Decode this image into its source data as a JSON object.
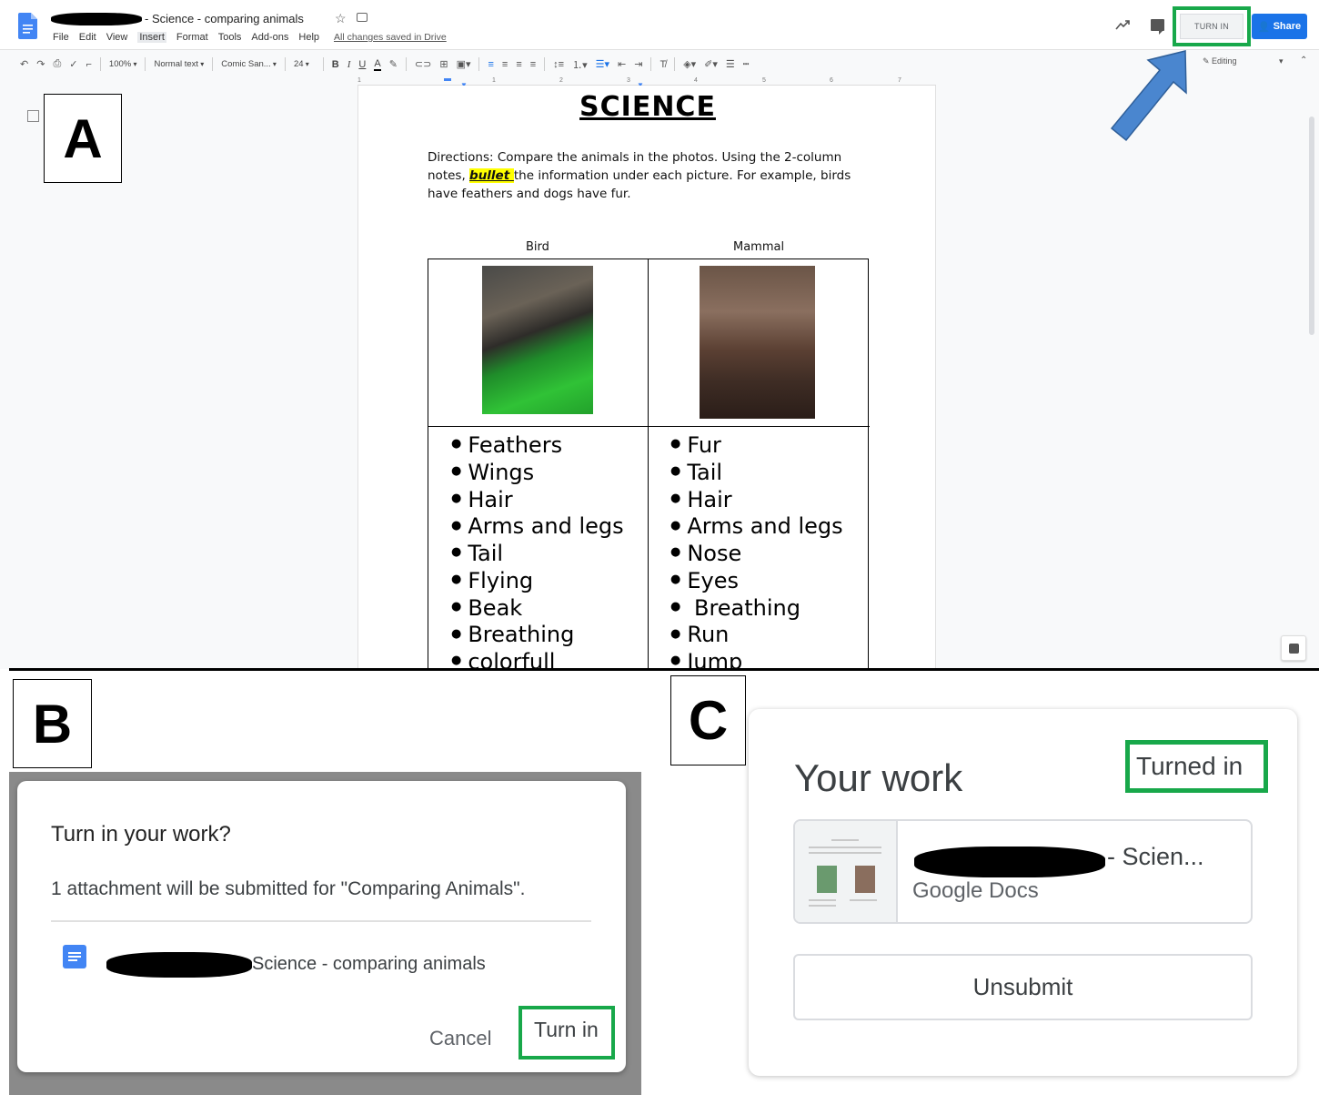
{
  "docs": {
    "title": "- Science - comparing animals",
    "menu": [
      "File",
      "Edit",
      "View",
      "Insert",
      "Format",
      "Tools",
      "Add-ons",
      "Help"
    ],
    "saved_status": "All changes saved in Drive",
    "turn_in_label": "TURN IN",
    "share_label": "Share",
    "toolbar": {
      "zoom": "100%",
      "style": "Normal text",
      "font": "Comic San...",
      "font_size": "24",
      "bold": "B",
      "italic": "I",
      "underline": "U",
      "text_color": "A",
      "editing_mode": "Editing"
    },
    "ruler_numbers": [
      "1",
      "1",
      "2",
      "3",
      "4",
      "5",
      "6",
      "7"
    ],
    "panel_label": "A",
    "page": {
      "title": "SCIENCE",
      "directions_before": "Directions: Compare the animals in the photos.  Using the 2-column notes, ",
      "directions_highlight": "bullet ",
      "directions_after": "the information under each picture. For example, birds have feathers and dogs have fur.",
      "bird_header": "Bird",
      "mammal_header": "Mammal",
      "bird_items": [
        "Feathers",
        "Wings",
        "Hair",
        "Arms and legs",
        "Tail",
        "Flying",
        "Beak",
        "Breathing",
        "colorfull"
      ],
      "mammal_items": [
        "Fur",
        "Tail",
        "Hair",
        "Arms and legs",
        "Nose",
        "Eyes",
        " Breathing",
        "Run",
        "Jump"
      ]
    }
  },
  "dialog": {
    "panel_label": "B",
    "title": "Turn in your work?",
    "message": "1 attachment will be submitted for \"Comparing Animals\".",
    "attachment_name": "Science - comparing animals",
    "cancel_label": "Cancel",
    "turn_in_label": "Turn in"
  },
  "your_work": {
    "panel_label": "C",
    "title": "Your work",
    "status": "Turned in",
    "attachment_title": "- Scien...",
    "attachment_type": "Google Docs",
    "unsubmit_label": "Unsubmit"
  },
  "colors": {
    "highlight_box": "#18a84a",
    "share_blue": "#1a73e8",
    "arrow_blue": "#4a86cf"
  }
}
